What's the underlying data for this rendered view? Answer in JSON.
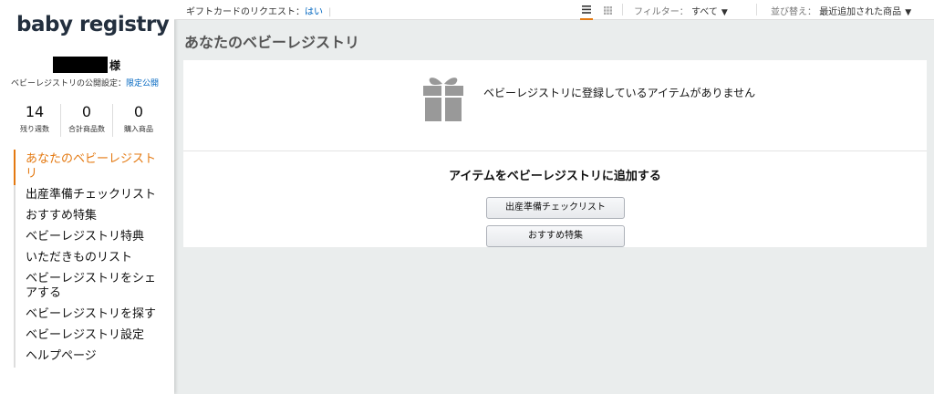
{
  "sidebar": {
    "logo": "baby registry",
    "honorific": "様",
    "privacy_label": "ベビーレジストリの公開設定：",
    "privacy_value": "限定公開",
    "stats": [
      {
        "value": "14",
        "label": "残り週数"
      },
      {
        "value": "0",
        "label": "合計商品数"
      },
      {
        "value": "0",
        "label": "購入商品"
      }
    ],
    "nav": [
      {
        "label": "あなたのベビーレジストリ"
      },
      {
        "label": "出産準備チェックリスト"
      },
      {
        "label": "おすすめ特集"
      },
      {
        "label": "ベビーレジストリ特典"
      },
      {
        "label": "いただきものリスト"
      },
      {
        "label": "ベビーレジストリをシェアする"
      },
      {
        "label": "ベビーレジストリを探す"
      },
      {
        "label": "ベビーレジストリ設定"
      },
      {
        "label": "ヘルプページ"
      }
    ]
  },
  "topbar": {
    "gift_label": "ギフトカードのリクエスト：",
    "gift_value": "はい",
    "filter_label": "フィルター：",
    "filter_value": "すべて",
    "sort_label": "並び替え：",
    "sort_value": "最近追加された商品"
  },
  "main": {
    "title": "あなたのベビーレジストリ",
    "empty_message": "ベビーレジストリに登録しているアイテムがありません",
    "add_heading": "アイテムをベビーレジストリに追加する",
    "buttons": {
      "checklist": "出産準備チェックリスト",
      "featured": "おすすめ特集"
    }
  },
  "colors": {
    "accent": "#e47911",
    "link": "#0066c0",
    "background": "#eaeded"
  }
}
